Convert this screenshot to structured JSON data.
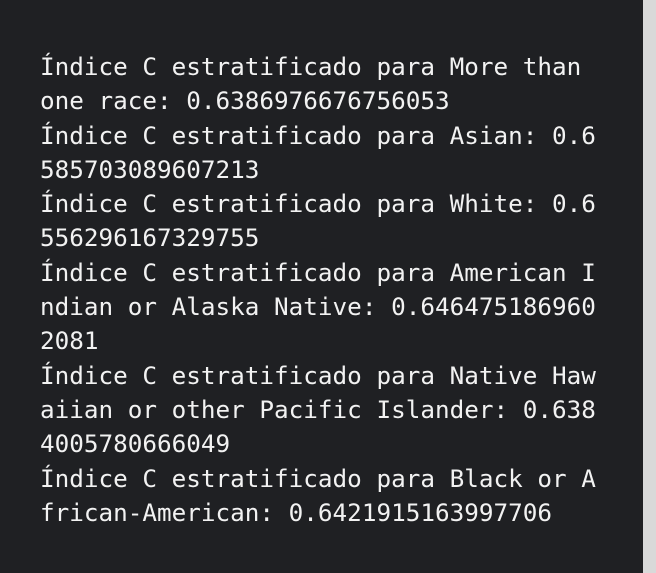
{
  "colors": {
    "background": "#1f2023",
    "text": "#f2f2f2",
    "scrollbar": "#e9e9e9"
  },
  "output": {
    "lines": [
      "Índice C estratificado para More than",
      "one race: 0.6386976676756053",
      "Índice C estratificado para Asian: 0.6",
      "585703089607213",
      "Índice C estratificado para White: 0.6",
      "556296167329755",
      "Índice C estratificado para American I",
      "ndian or Alaska Native: 0.646475186960",
      "2081",
      "Índice C estratificado para Native Haw",
      "aiian or other Pacific Islander: 0.638",
      "4005780666049",
      "Índice C estratificado para Black or A",
      "frican-American: 0.6421915163997706"
    ]
  }
}
